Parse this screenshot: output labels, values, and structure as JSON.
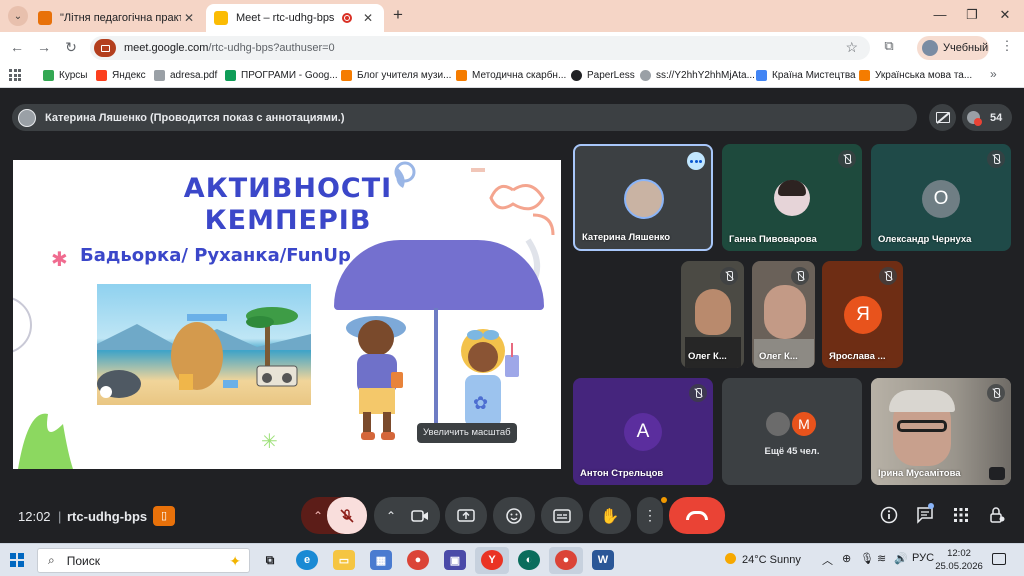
{
  "browser": {
    "tabs": [
      {
        "title": "\"Літня педагогічна практика 2",
        "favicon_color": "#e8710a"
      },
      {
        "title": "Meet – rtc-udhg-bps",
        "favicon_color": "#fbbc04",
        "active": true
      }
    ],
    "url_host": "meet.google.com",
    "url_path": "/rtc-udhg-bps?authuser=0",
    "profile_label": "Учебный",
    "bookmarks": [
      {
        "label": "Курсы",
        "icon_color": "#34a853"
      },
      {
        "label": "Яндекс",
        "icon_color": "#fc3f1d"
      },
      {
        "label": "adresa.pdf",
        "icon_color": "#9aa0a6"
      },
      {
        "label": "ПРОГРАМИ - Goog...",
        "icon_color": "#0f9d58"
      },
      {
        "label": "Блог учителя музи...",
        "icon_color": "#f57c00"
      },
      {
        "label": "Методична скарбн...",
        "icon_color": "#f57c00"
      },
      {
        "label": "PaperLess",
        "icon_color": "#202124"
      },
      {
        "label": "ss://Y2hhY2hhMjAta...",
        "icon_color": "#9aa0a6"
      },
      {
        "label": "Країна Мистецтва",
        "icon_color": "#4285f4"
      },
      {
        "label": "Українська мова та...",
        "icon_color": "#f57c00"
      }
    ]
  },
  "meet": {
    "presenter_banner": "Катерина Ляшенко (Проводится показ с аннотациями.)",
    "participant_count": "54",
    "slide": {
      "title_line1": "АКТИВНОСТІ",
      "title_line2": "КЕМПЕРІВ",
      "subtitle": "Бадьорка/ Руханка/FunUp",
      "zoom_tooltip": "Увеличить масштаб"
    },
    "tiles": [
      {
        "name": "Катерина Ляшенко",
        "bg": "#3c4043"
      },
      {
        "name": "Ганна Пивоварова",
        "bg": "#1e4a3d"
      },
      {
        "name": "Олександр Чернуха",
        "bg": "#1f4a48",
        "initial": "О",
        "avatar_color": "#6f7e84"
      },
      {
        "name": "Олег К...",
        "bg": "#4b4a44"
      },
      {
        "name": "Олег К...",
        "bg": "#6a6159"
      },
      {
        "name": "Ярослава ...",
        "bg": "#6e2d14",
        "initial": "Я",
        "avatar_color": "#e8531c"
      },
      {
        "name": "Антон Стрельцов",
        "bg": "#45257d",
        "initial": "А",
        "avatar_color": "#5b2e9e"
      },
      {
        "name": "Ещё 45 чел.",
        "bg": "#3c4043",
        "initial": "М",
        "avatar_color": "#e8531c"
      },
      {
        "name": "Ірина Мусамітова",
        "bg": "#8e8c8a"
      }
    ],
    "time": "12:02",
    "meeting_code": "rtc-udhg-bps"
  },
  "taskbar": {
    "search_placeholder": "Поиск",
    "weather": "24°C  Sunny",
    "lang": "РУС",
    "time": "12:02",
    "date": "25.05.2026"
  }
}
